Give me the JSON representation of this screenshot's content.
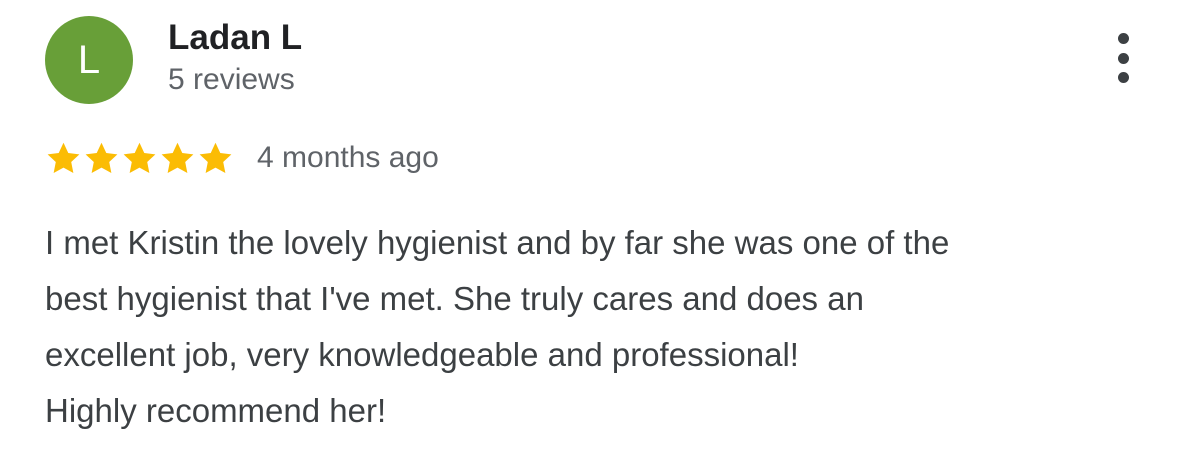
{
  "review": {
    "author": {
      "initial": "L",
      "name": "Ladan L",
      "review_count": "5 reviews",
      "avatar_color": "#689f38"
    },
    "menu_icon": "more-vertical-icon",
    "rating": {
      "stars": 5,
      "max": 5,
      "star_icon": "star-icon",
      "star_color": "#fbbc04"
    },
    "date": "4 months ago",
    "text_lines": [
      "I met Kristin the lovely hygienist and by far she was one of the",
      "best hygienist that I've met. She truly cares and does an",
      "excellent job, very knowledgeable and professional!",
      "Highly recommend her!"
    ]
  }
}
